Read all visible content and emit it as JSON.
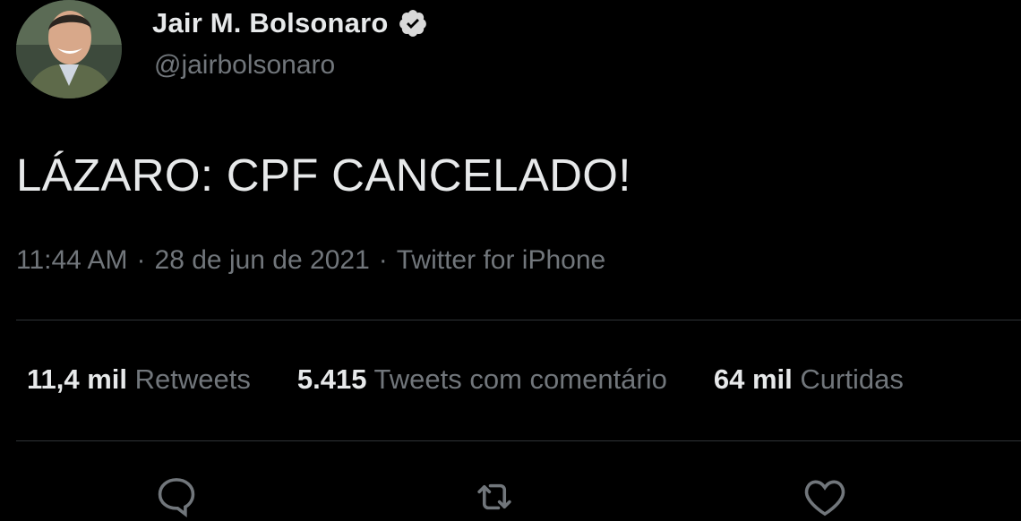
{
  "tweet": {
    "display_name": "Jair M. Bolsonaro",
    "handle": "@jairbolsonaro",
    "verified": true,
    "text": "LÁZARO: CPF CANCELADO!",
    "time": "11:44 AM",
    "date": "28 de jun de 2021",
    "source": "Twitter for iPhone",
    "separator": "·"
  },
  "stats": {
    "retweets_count": "11,4 mil",
    "retweets_label": "Retweets",
    "quotes_count": "5.415",
    "quotes_label": "Tweets com comentário",
    "likes_count": "64 mil",
    "likes_label": "Curtidas"
  },
  "actions": [
    "reply-icon",
    "retweet-icon",
    "like-icon"
  ],
  "colors": {
    "background": "#000000",
    "primary_text": "#e7e9ea",
    "secondary_text": "#71767b",
    "divider": "#2f3336"
  }
}
